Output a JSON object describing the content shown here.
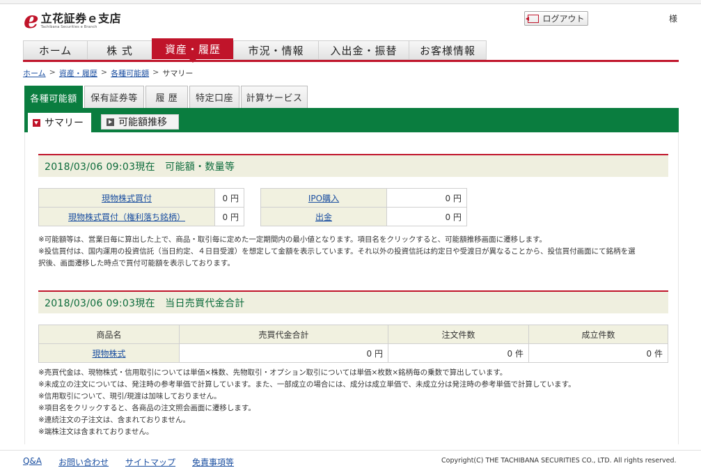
{
  "header": {
    "logo_letter": "e",
    "logo_name": "立花証券ｅ支店",
    "logo_sub": "Tachibana Securities e Branch",
    "logout_label": "ログアウト",
    "user_suffix": "様"
  },
  "mainnav": {
    "items": [
      {
        "label": "ホーム"
      },
      {
        "label": "株 式"
      },
      {
        "label": "資産・履歴"
      },
      {
        "label": "市況・情報"
      },
      {
        "label": "入出金・振替"
      },
      {
        "label": "お客様情報"
      }
    ],
    "active": "資産・履歴"
  },
  "breadcrumb": {
    "items": [
      "ホーム",
      "資産・履歴",
      "各種可能額",
      "サマリー"
    ],
    "separator": ">"
  },
  "subtabs": {
    "items": [
      "各種可能額",
      "保有証券等",
      "履 歴",
      "特定口座",
      "計算サービス"
    ],
    "active": "各種可能額"
  },
  "greentabs": {
    "active": "サマリー",
    "inactive": "可能額推移"
  },
  "section1": {
    "title": "2018/03/06 09:03現在　可能額・数量等",
    "left_rows": [
      {
        "label": "現物株式買付",
        "value": "0 円"
      },
      {
        "label": "現物株式買付（権利落ち銘柄）",
        "value": "0 円"
      }
    ],
    "right_rows": [
      {
        "label": "IPO購入",
        "value": "0 円"
      },
      {
        "label": "出金",
        "value": "0 円"
      }
    ],
    "notes": [
      "※可能額等は、営業日毎に算出した上で、商品・取引毎に定めた一定期間内の最小値となります。項目名をクリックすると、可能額推移画面に遷移します。",
      "※投信買付は、国内運用の投資信託（当日約定、４日目受渡）を想定して金額を表示しています。それ以外の投資信託は約定日や受渡日が異なることから、投信買付画面にて銘柄を選",
      "択後、画面遷移した時点で買付可能額を表示しております。"
    ]
  },
  "section2": {
    "title": "2018/03/06 09:03現在　当日売買代金合計",
    "columns": [
      "商品名",
      "売買代金合計",
      "注文件数",
      "成立件数"
    ],
    "rows": [
      {
        "name": "現物株式",
        "total": "0 円",
        "orders": "0 件",
        "executed": "0 件"
      }
    ],
    "notes": [
      "※売買代金は、現物株式・信用取引については単価×株数、先物取引・オプション取引については単価×枚数×銘柄毎の乗数で算出しています。",
      "※未成立の注文については、発注時の参考単価で計算しています。また、一部成立の場合には、成分は成立単価で、未成立分は発注時の参考単価で計算しています。",
      "※信用取引について、現引/現渡は加味しておりません。",
      "※項目名をクリックすると、各商品の注文照会画面に遷移します。",
      "※連続注文の子注文は、含まれておりません。",
      "※端株注文は含まれておりません。"
    ]
  },
  "footer": {
    "links": [
      "Q&A",
      "お問い合わせ",
      "サイトマップ",
      "免責事項等"
    ],
    "copyright": "Copyright(C) THE TACHIBANA SECURITIES CO., LTD. All rights reserved."
  },
  "colors": {
    "brand_red": "#c0142a",
    "brand_green": "#0a7d3f",
    "link_blue": "#1a4ea0"
  }
}
